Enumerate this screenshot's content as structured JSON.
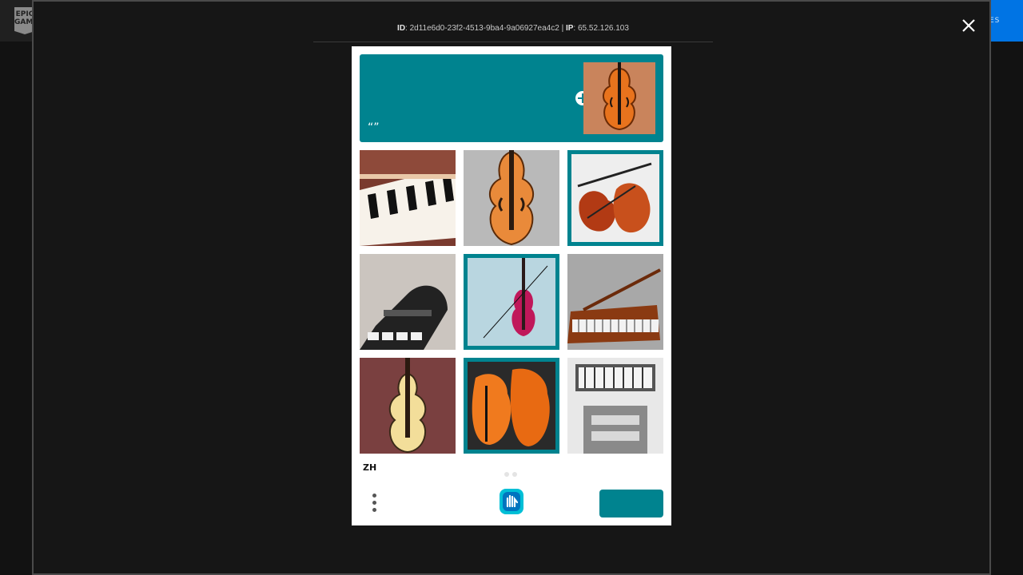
{
  "background": {
    "logo_text": "EPIC GAMES",
    "header_button_label": "ES"
  },
  "dialog": {
    "info": {
      "id_prefix": "ID",
      "id_label": "ID",
      "id_value": ": 2d11e6d0-23f2-4513-9ba4-9a06927ea4c2 | ",
      "ip_label": "IP",
      "ip_value": ": 65.52.126.103"
    }
  },
  "captcha": {
    "prompt_title": "",
    "prompt_subtitle": "“”",
    "language": "ZH",
    "report_label": "",
    "verify_label": "",
    "tiles": [
      {
        "subject": "piano keys",
        "selected": false
      },
      {
        "subject": "violin",
        "selected": false
      },
      {
        "subject": "violins pair",
        "selected": true
      },
      {
        "subject": "grand piano",
        "selected": false
      },
      {
        "subject": "violin pink",
        "selected": true
      },
      {
        "subject": "grand piano brown",
        "selected": false
      },
      {
        "subject": "violin cream",
        "selected": false
      },
      {
        "subject": "violins orange",
        "selected": true
      },
      {
        "subject": "piano grayscale",
        "selected": false
      }
    ],
    "colors": {
      "accent": "#00838f",
      "report": "#e06464"
    }
  }
}
